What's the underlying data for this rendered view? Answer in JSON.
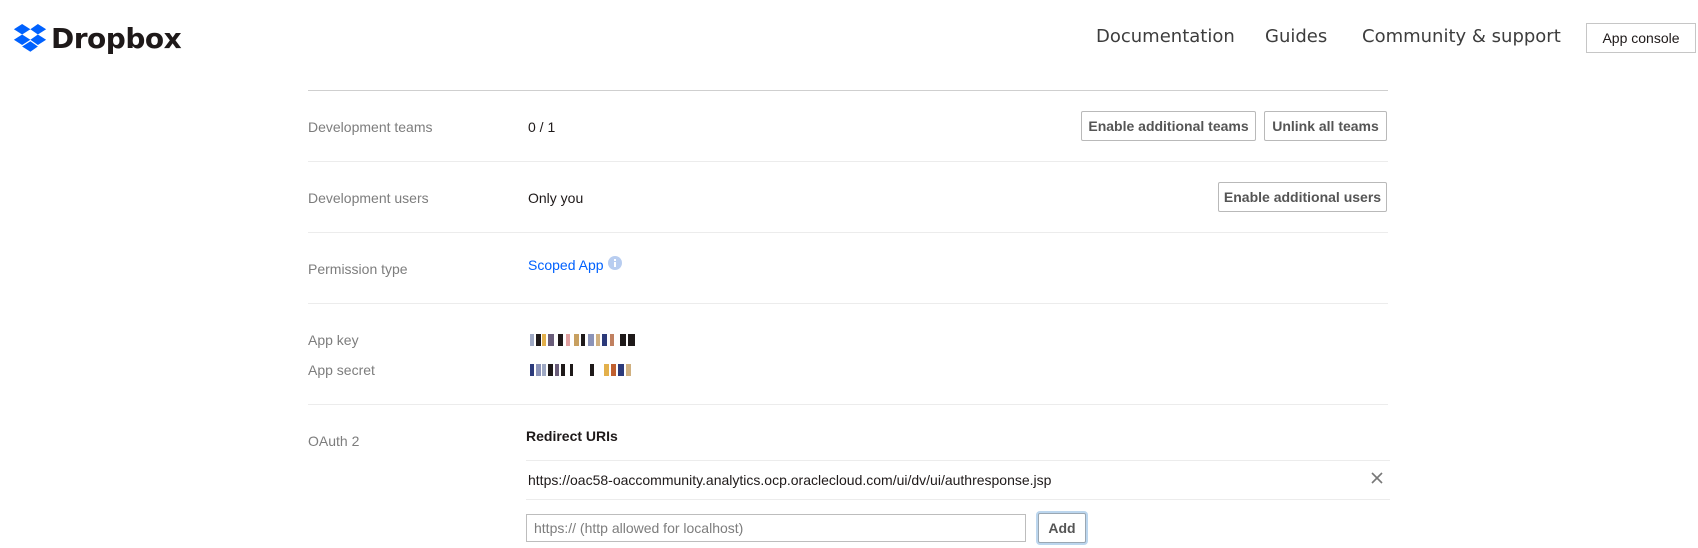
{
  "header": {
    "brand": "Dropbox",
    "nav": [
      "Documentation",
      "Guides",
      "Community & support"
    ],
    "console_button": "App console"
  },
  "rows": {
    "dev_teams": {
      "label": "Development teams",
      "value": "0 / 1",
      "btn_enable": "Enable additional teams",
      "btn_unlink": "Unlink all teams"
    },
    "dev_users": {
      "label": "Development users",
      "value": "Only you",
      "btn_enable": "Enable additional users"
    },
    "permission": {
      "label": "Permission type",
      "value": "Scoped App"
    },
    "app_key": {
      "label": "App key"
    },
    "app_secret": {
      "label": "App secret"
    },
    "oauth": {
      "label": "OAuth 2",
      "heading": "Redirect URIs",
      "uri": "https://oac58-oaccommunity.analytics.ocp.oraclecloud.com/ui/dv/ui/authresponse.jsp",
      "input_placeholder": "https:// (http allowed for localhost)",
      "add_label": "Add"
    }
  },
  "colors": {
    "link": "#0061fe",
    "brand": "#0061fe"
  },
  "icons": [
    "dropbox-logo-icon",
    "info-icon",
    "close-icon"
  ]
}
